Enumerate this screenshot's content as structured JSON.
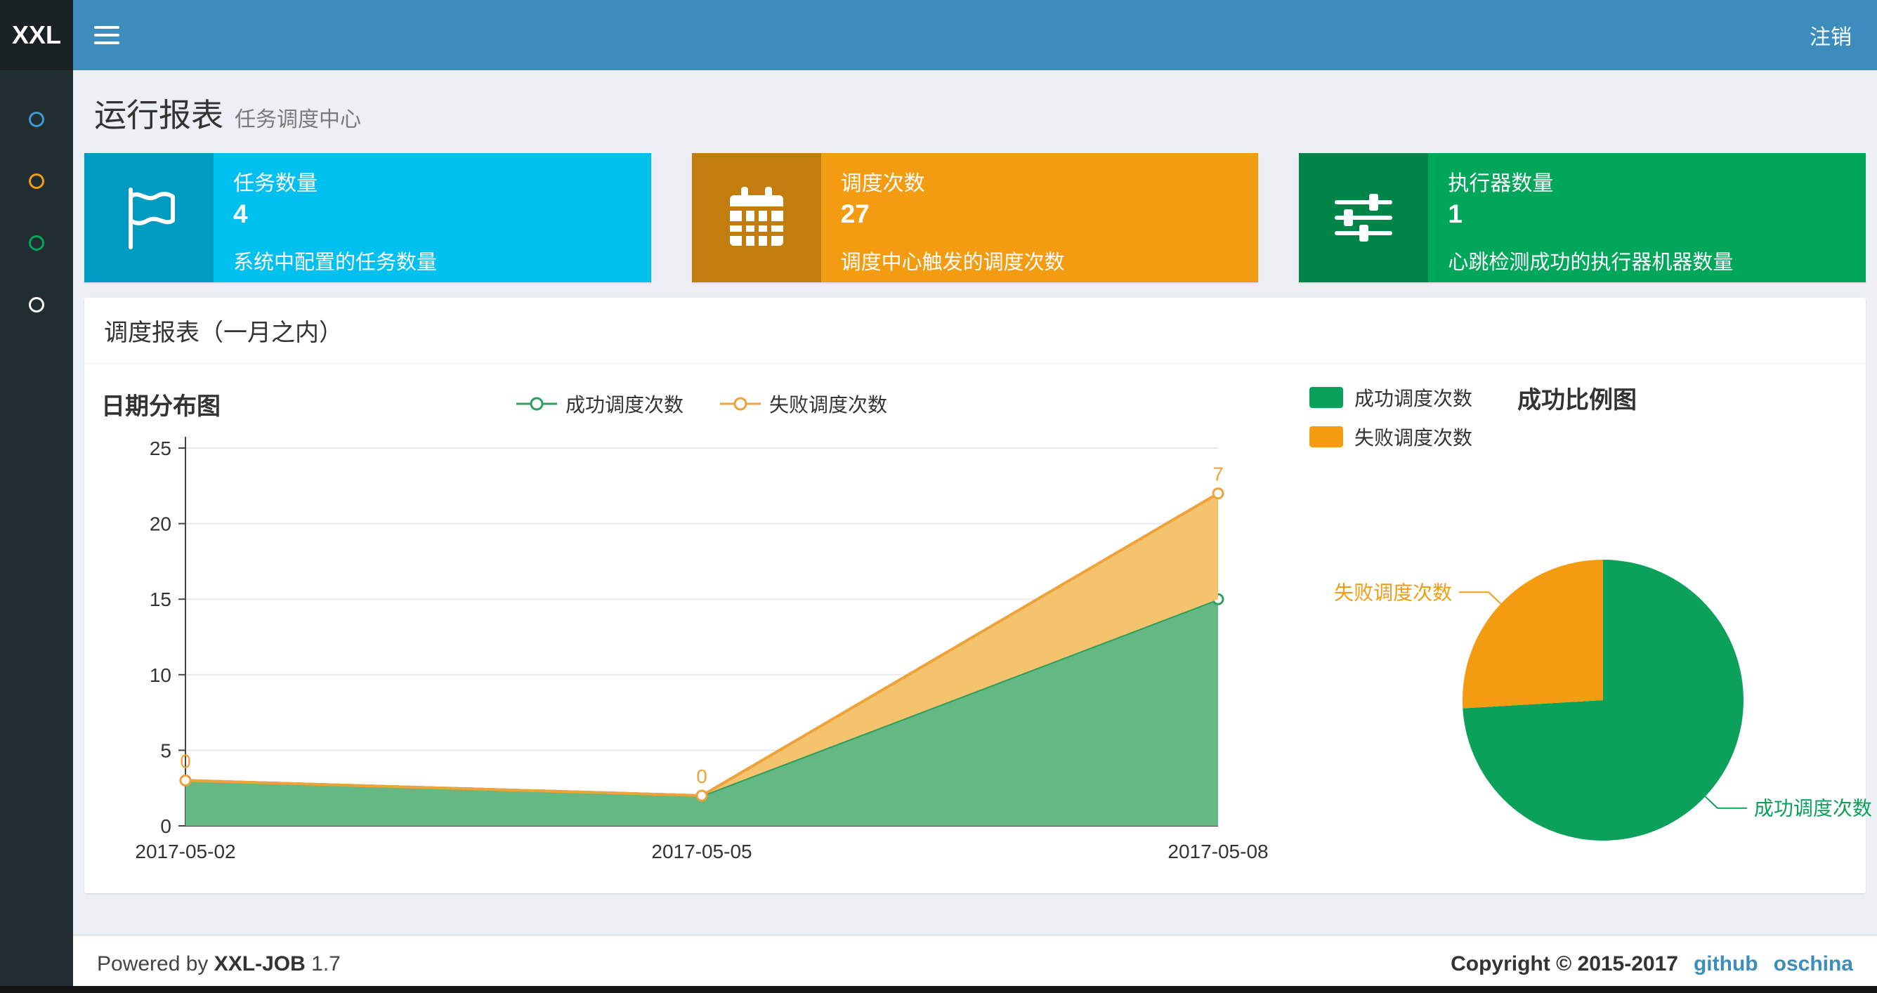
{
  "navbar": {
    "logo_text": "XXL",
    "logout_label": "注销"
  },
  "sidebar": {
    "items": [
      {
        "name": "nav-dot-report",
        "color": "#3c9ccd"
      },
      {
        "name": "nav-dot-jobs",
        "color": "#f39c12"
      },
      {
        "name": "nav-dot-log",
        "color": "#00a65a"
      },
      {
        "name": "nav-dot-help",
        "color": "#ffffff"
      }
    ]
  },
  "page_header": {
    "title": "运行报表",
    "subtitle": "任务调度中心"
  },
  "info_boxes": [
    {
      "title": "任务数量",
      "value": "4",
      "desc": "系统中配置的任务数量",
      "bg": "#00c0ef",
      "icon_bg": "#009bc1",
      "icon": "flag-icon"
    },
    {
      "title": "调度次数",
      "value": "27",
      "desc": "调度中心触发的调度次数",
      "bg": "#f39c12",
      "icon_bg": "#c27d0e",
      "icon": "calendar-icon"
    },
    {
      "title": "执行器数量",
      "value": "1",
      "desc": "心跳检测成功的执行器机器数量",
      "bg": "#00a65a",
      "icon_bg": "#008548",
      "icon": "sliders-icon"
    }
  ],
  "panel": {
    "title": "调度报表（一月之内）"
  },
  "chart_data": [
    {
      "type": "area",
      "title": "日期分布图",
      "x": [
        "2017-05-02",
        "2017-05-05",
        "2017-05-08"
      ],
      "ylim": [
        0,
        25
      ],
      "yticks": [
        0,
        5,
        10,
        15,
        20,
        25
      ],
      "grid": true,
      "stacked": true,
      "legend_position": "top",
      "series": [
        {
          "name": "成功调度次数",
          "values": [
            3,
            2,
            15
          ],
          "color": "#2e9e5e",
          "fill": "#63b883"
        },
        {
          "name": "失败调度次数",
          "values": [
            0,
            0,
            7
          ],
          "color": "#f0a23a",
          "fill": "#f4c36d",
          "point_labels": [
            "0",
            "0",
            "7"
          ]
        }
      ]
    },
    {
      "type": "pie",
      "title": "成功比例图",
      "legend": [
        "成功调度次数",
        "失败调度次数"
      ],
      "slices": [
        {
          "name": "成功调度次数",
          "value": 20,
          "color": "#0ba15a"
        },
        {
          "name": "失败调度次数",
          "value": 7,
          "color": "#f39c12"
        }
      ]
    }
  ],
  "footer": {
    "powered_prefix": "Powered by",
    "brand": "XXL-JOB",
    "version": "1.7",
    "copyright": "Copyright © 2015-2017",
    "links": [
      "github",
      "oschina"
    ]
  },
  "colors": {
    "navbar": "#3c8dbc",
    "sidebar": "#222d32",
    "content_bg": "#ecf0f5",
    "link": "#3c8dbc"
  }
}
